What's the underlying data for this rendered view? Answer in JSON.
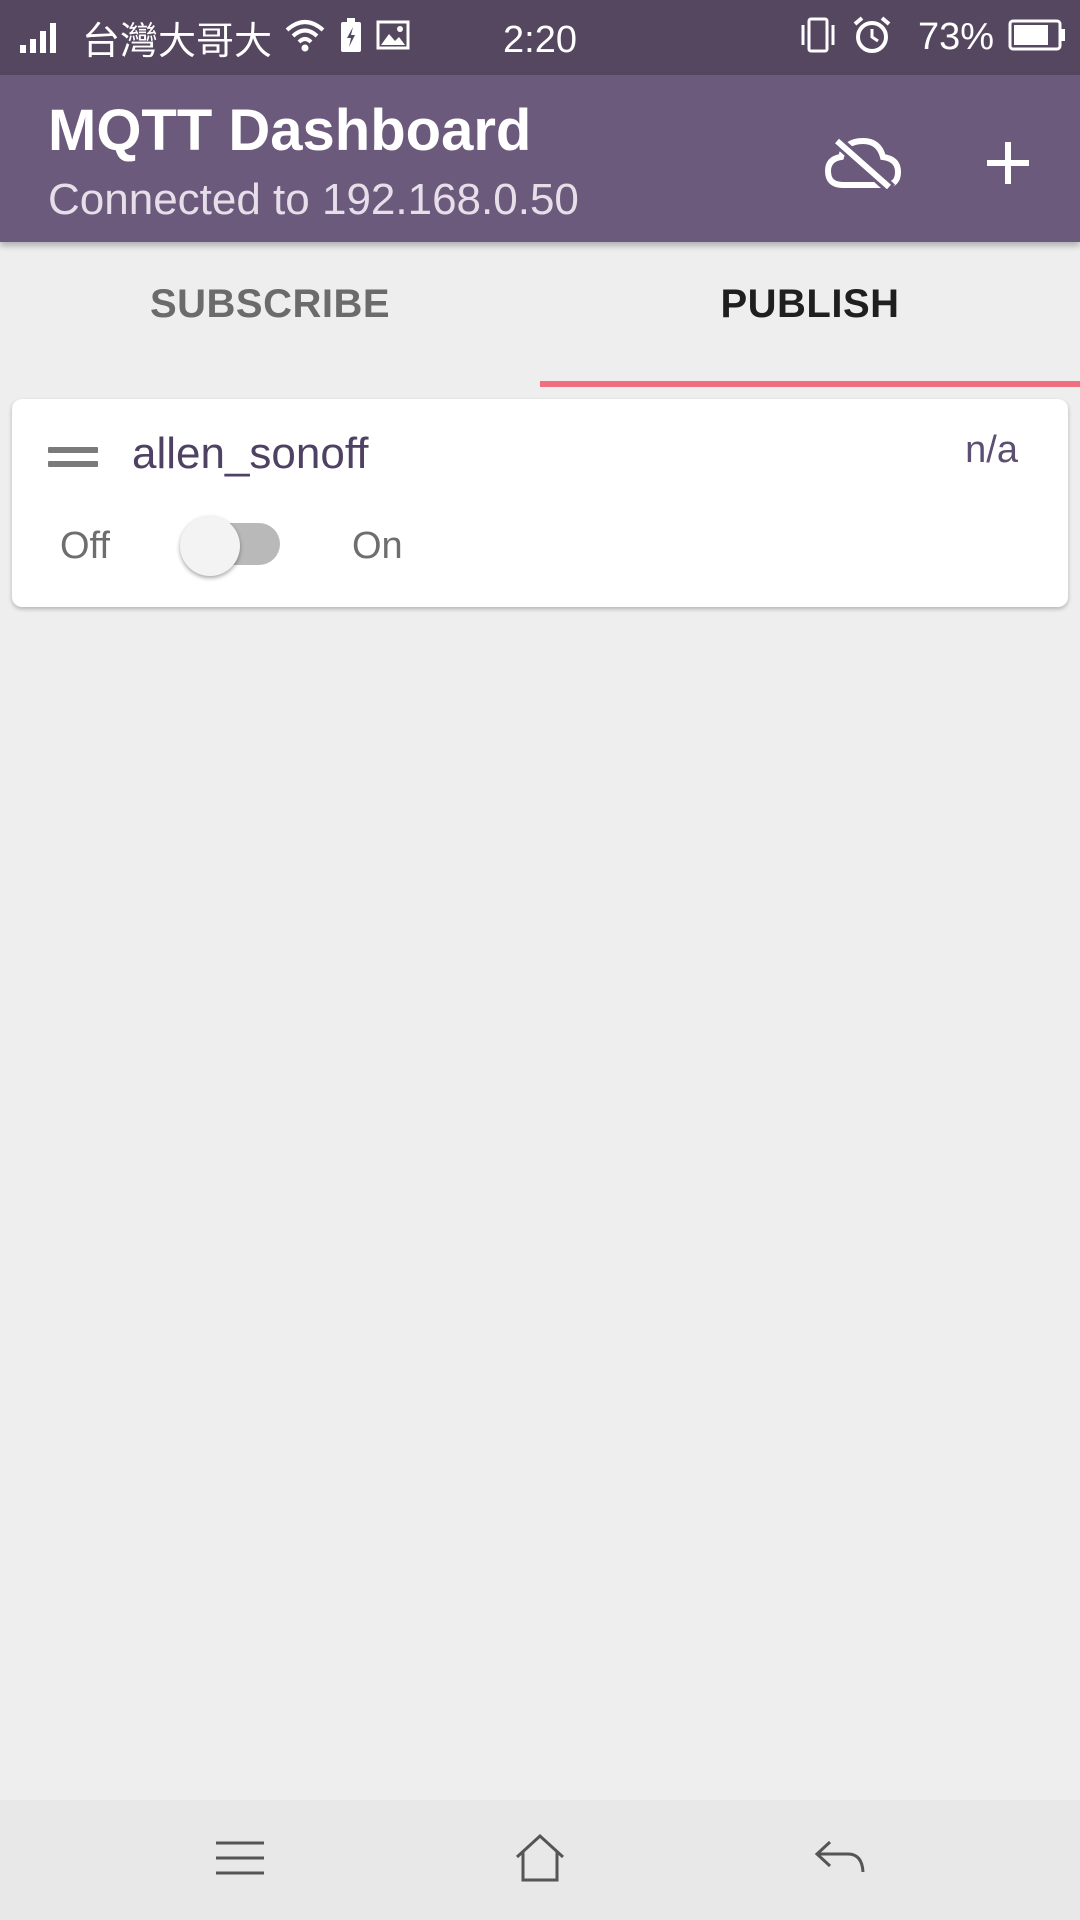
{
  "status_bar": {
    "carrier": "台灣大哥大",
    "time": "2:20",
    "battery_percent": "73%",
    "icons": [
      "signal-icon",
      "wifi-icon",
      "battery-saver-icon",
      "image-icon",
      "vibrate-icon",
      "alarm-icon",
      "battery-icon"
    ]
  },
  "app_bar": {
    "title": "MQTT Dashboard",
    "subtitle": "Connected to 192.168.0.50",
    "actions": [
      "cloud-off-icon",
      "add-icon"
    ],
    "color": "#6c5a7c"
  },
  "tabs": {
    "items": [
      {
        "label": "SUBSCRIBE",
        "selected": false
      },
      {
        "label": "PUBLISH",
        "selected": true
      }
    ],
    "indicator_color": "#f06e7e"
  },
  "card": {
    "title": "allen_sonoff",
    "value": "n/a",
    "off_label": "Off",
    "on_label": "On",
    "switch_on": false
  },
  "nav_bar": {
    "icons": [
      "menu-icon",
      "home-icon",
      "back-icon"
    ]
  }
}
